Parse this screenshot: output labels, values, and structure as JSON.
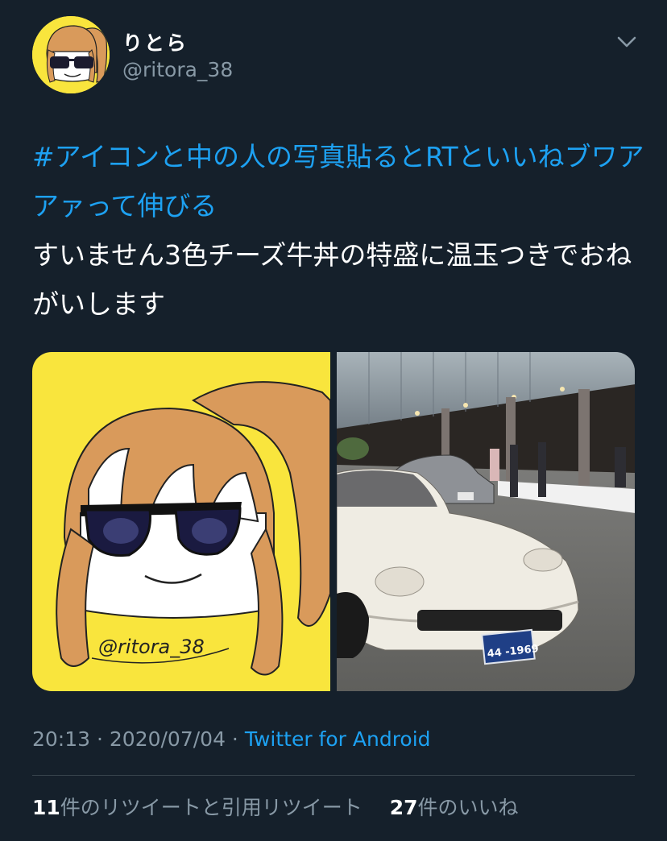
{
  "user": {
    "display_name": "りとら",
    "handle": "@ritora_38"
  },
  "tweet": {
    "hashtag": "#アイコンと中の人の写真貼るとRTといいねブワアアァって伸びる",
    "body": "すいません3色チーズ牛丼の特盛に温玉つきでおねがいします"
  },
  "media": {
    "drawing_signature": "@ritora_38",
    "plate_text": "44 -1969"
  },
  "meta": {
    "time": "20:13",
    "sep1": " · ",
    "date": "2020/07/04",
    "sep2": " · ",
    "source": "Twitter for Android"
  },
  "stats": {
    "retweets_count": "11",
    "retweets_label": "件のリツイートと引用リツイート",
    "likes_count": "27",
    "likes_label": "件のいいね"
  },
  "colors": {
    "background": "#15202b",
    "accent": "#1da1f2",
    "secondary_text": "#8899a6",
    "divider": "#38444d"
  }
}
